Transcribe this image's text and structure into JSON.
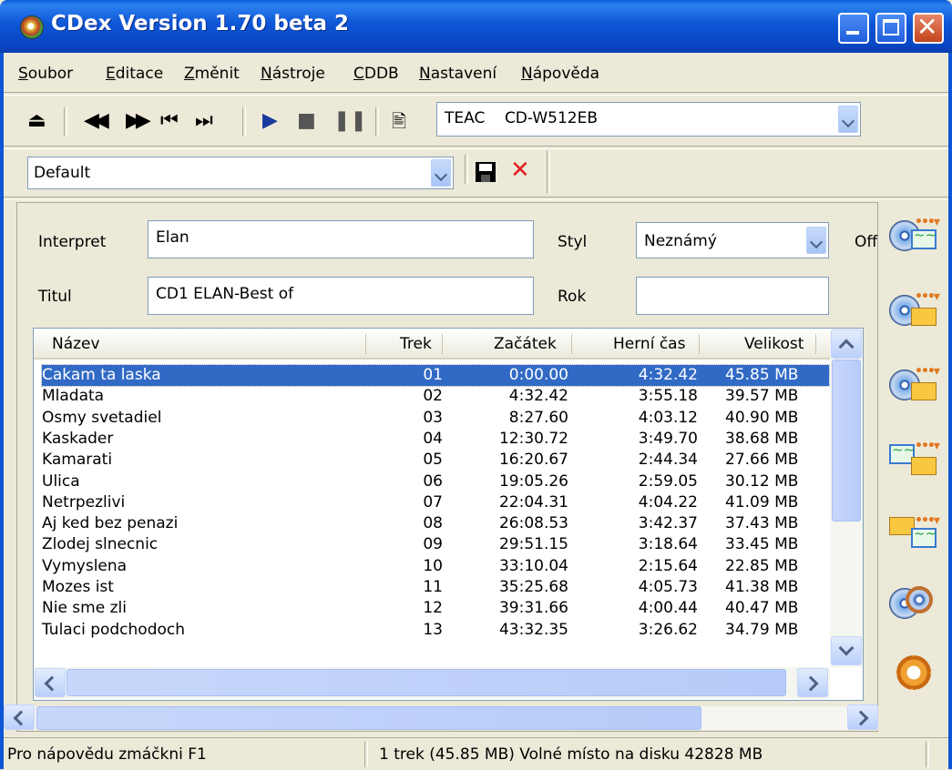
{
  "window": {
    "title": "CDex Version 1.70 beta 2"
  },
  "menu": [
    "Soubor",
    "Editace",
    "Změnit",
    "Nástroje",
    "CDDB",
    "Nastavení",
    "Nápověda"
  ],
  "toolbar": {
    "drive": "TEAC    CD-W512EB",
    "profile": "Default"
  },
  "form": {
    "interpret_label": "Interpret",
    "interpret_value": "Elan",
    "titul_label": "Titul",
    "titul_value": "CD1 ELAN-Best of",
    "styl_label": "Styl",
    "styl_value": "Neznámý",
    "rok_label": "Rok",
    "rok_value": "",
    "off_label": "Off"
  },
  "table": {
    "columns": [
      "Název",
      "Trek",
      "Začátek",
      "Herní čas",
      "Velikost"
    ],
    "rows": [
      {
        "name": "Cakam ta laska",
        "trek": "01",
        "start": "0:00.00",
        "time": "4:32.42",
        "size": "45.85 MB"
      },
      {
        "name": "Mladata",
        "trek": "02",
        "start": "4:32.42",
        "time": "3:55.18",
        "size": "39.57 MB"
      },
      {
        "name": "Osmy svetadiel",
        "trek": "03",
        "start": "8:27.60",
        "time": "4:03.12",
        "size": "40.90 MB"
      },
      {
        "name": "Kaskader",
        "trek": "04",
        "start": "12:30.72",
        "time": "3:49.70",
        "size": "38.68 MB"
      },
      {
        "name": "Kamarati",
        "trek": "05",
        "start": "16:20.67",
        "time": "2:44.34",
        "size": "27.66 MB"
      },
      {
        "name": "Ulica",
        "trek": "06",
        "start": "19:05.26",
        "time": "2:59.05",
        "size": "30.12 MB"
      },
      {
        "name": "Netrpezlivi",
        "trek": "07",
        "start": "22:04.31",
        "time": "4:04.22",
        "size": "41.09 MB"
      },
      {
        "name": "Aj ked bez penazi",
        "trek": "08",
        "start": "26:08.53",
        "time": "3:42.37",
        "size": "37.43 MB"
      },
      {
        "name": "Zlodej slnecnic",
        "trek": "09",
        "start": "29:51.15",
        "time": "3:18.64",
        "size": "33.45 MB"
      },
      {
        "name": "Vymyslena",
        "trek": "10",
        "start": "33:10.04",
        "time": "2:15.64",
        "size": "22.85 MB"
      },
      {
        "name": "Mozes ist",
        "trek": "11",
        "start": "35:25.68",
        "time": "4:05.73",
        "size": "41.38 MB"
      },
      {
        "name": "Nie sme zli",
        "trek": "12",
        "start": "39:31.66",
        "time": "4:00.44",
        "size": "40.47 MB"
      },
      {
        "name": "Tulaci podchodoch",
        "trek": "13",
        "start": "43:32.35",
        "time": "3:26.62",
        "size": "34.79 MB"
      }
    ],
    "selected_index": 0
  },
  "status": {
    "help": "Pro nápovědu zmáčkni F1",
    "info": "1 trek (45.85 MB) Volné místo na disku 42828 MB"
  }
}
